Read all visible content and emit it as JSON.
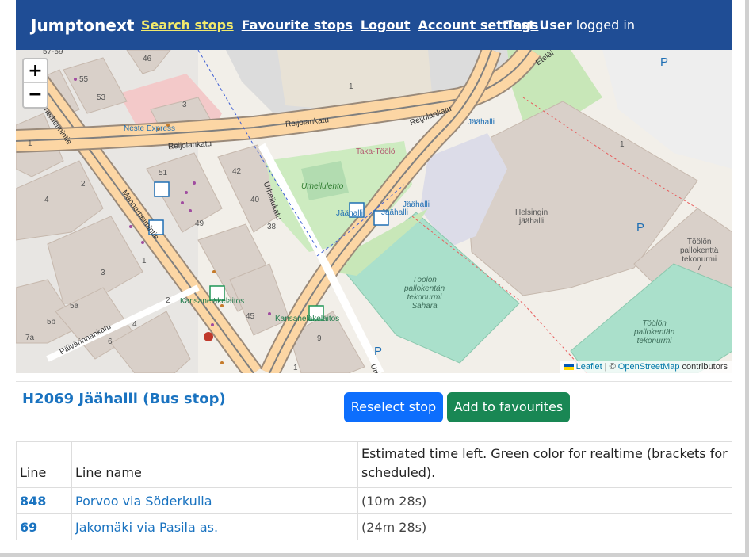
{
  "navbar": {
    "brand": "Jumptonext",
    "links": [
      {
        "label": "Search stops"
      },
      {
        "label": "Favourite stops"
      },
      {
        "label": "Logout"
      },
      {
        "label": "Account settings"
      }
    ],
    "user_name": "Test User",
    "user_status": "logged in"
  },
  "map": {
    "zoom_in": "+",
    "zoom_out": "−",
    "attribution": {
      "leaflet": "Leaflet",
      "sep": "| ©",
      "osm": "OpenStreetMap",
      "contributors": "contributors"
    },
    "labels": {
      "mannerheimintie_a": "Mannerheimintie",
      "mannerheimintie_b": "Mannerheimintie",
      "reijolankatu_a": "Reijolankatu",
      "reijolankatu_b": "Reijolankatu",
      "reijolankatu_c": "Reijolankatu",
      "urheilukatu": "Urheilukatu",
      "urheilukatu_b": "Urhe",
      "paivarinnankatu": "Päivärinnankatu",
      "etelainen": "Eteläi",
      "neste": "Neste Express",
      "taka_toolo": "Taka-Töölö",
      "urheilulehto": "Urheilulehto",
      "jaahalli_stop_a": "Jäähalli",
      "jaahalli_stop_b": "Jäähalli",
      "jaahalli_stop_c": "Jäähalli",
      "jaahalli_stop_d": "Jäähalli",
      "helsingin_jaahalli_1": "Helsingin",
      "helsingin_jaahalli_2": "jäähalli",
      "toolon_pt_1": "Töölön",
      "toolon_pt_2": "pallokenttä",
      "toolon_pt_3": "tekonurmi",
      "toolon_pt_4": "7",
      "toolon_sahara_1": "Töölön",
      "toolon_sahara_2": "pallokentän",
      "toolon_sahara_3": "tekonurmi",
      "toolon_sahara_4": "Sahara",
      "toolon_te_1": "Töölön",
      "toolon_te_2": "pallokentän",
      "toolon_te_3": "tekonurmi",
      "kansaneläke_a": "Kansaneläkelaitos",
      "kansaneläke_b": "Kansaneläkelaitos",
      "parking_a": "P",
      "parking_b": "P",
      "parking_c": "P",
      "nums": [
        "57-59",
        "55",
        "53",
        "46",
        "3",
        "1",
        "1",
        "2",
        "4",
        "51",
        "42",
        "40",
        "38",
        "49",
        "3",
        "1",
        "2",
        "5a",
        "5b",
        "7a",
        "4",
        "6",
        "45",
        "9",
        "1",
        "1"
      ]
    }
  },
  "stop": {
    "title": "H2069 Jäähalli (Bus stop)",
    "reselect_label": "Reselect stop",
    "favourite_label": "Add to favourites"
  },
  "table": {
    "headers": [
      "Line",
      "Line name",
      "Estimated time left. Green color for realtime (brackets for scheduled)."
    ],
    "rows": [
      {
        "line": "848",
        "name": "Porvoo via Söderkulla",
        "time": "(10m 28s)"
      },
      {
        "line": "69",
        "name": "Jakomäki via Pasila as.",
        "time": "(24m 28s)"
      }
    ]
  },
  "colors": {
    "navbar": "#1f4d95",
    "active_link": "#f2e96b",
    "link": "#1a73c0",
    "reselect": "#0d6efd",
    "favourite": "#198754",
    "road_major": "#fcd6a4",
    "pitch": "#aae0cb",
    "park": "#c8facc",
    "building": "#d9d0c9"
  }
}
